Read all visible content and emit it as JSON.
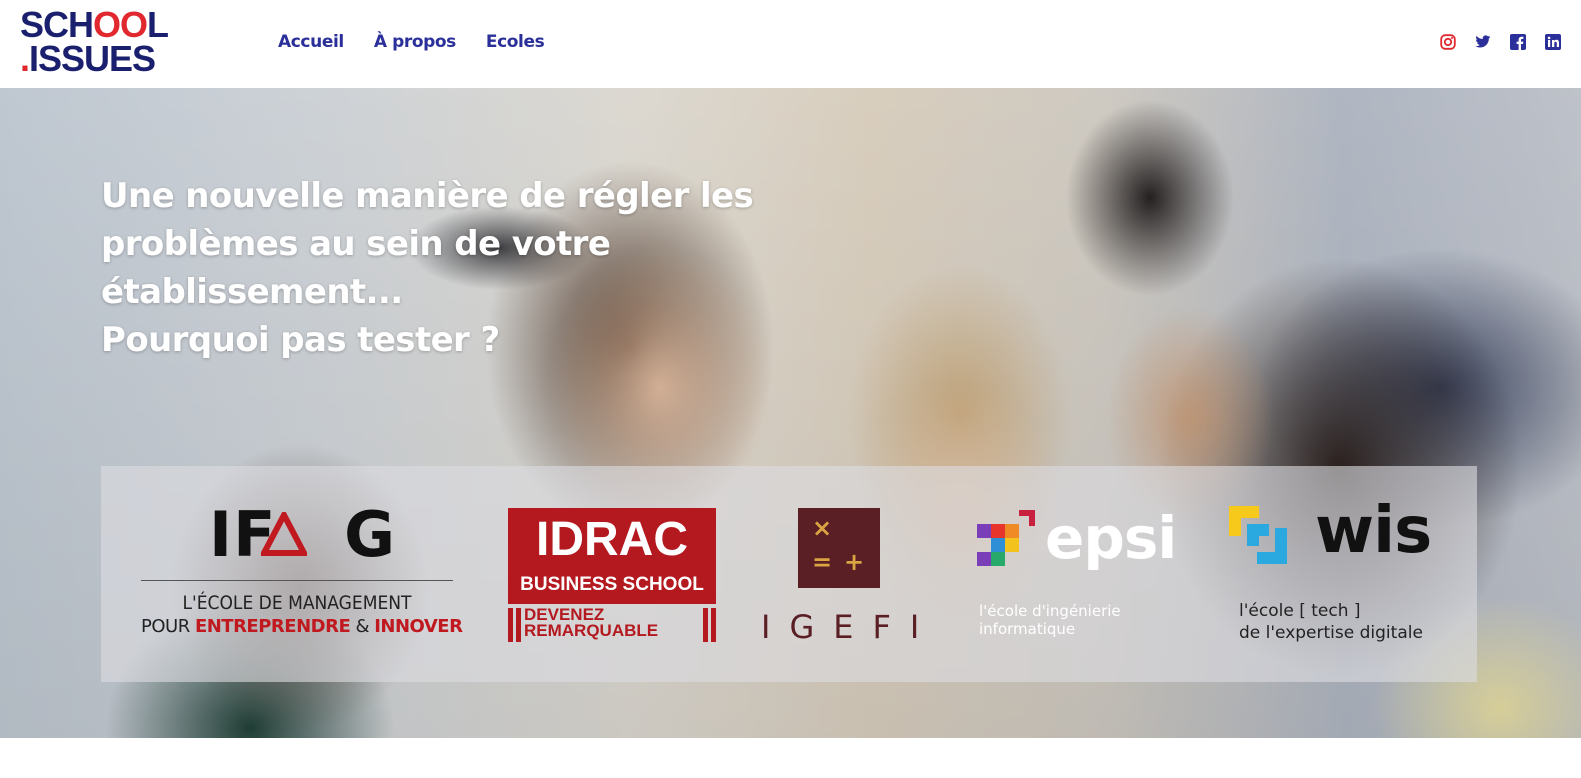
{
  "logo": {
    "line1_a": "SCH",
    "line1_o1": "O",
    "line1_o2": "O",
    "line1_b": "L",
    "line2_dot": ".",
    "line2": "ISSUES"
  },
  "nav": {
    "items": [
      {
        "label": "Accueil"
      },
      {
        "label": "À propos"
      },
      {
        "label": "Ecoles"
      }
    ]
  },
  "social": {
    "icons": [
      "instagram-icon",
      "twitter-icon",
      "facebook-icon",
      "linkedin-icon"
    ],
    "color": "#2a2f9a",
    "instagram_color": "#e0282e"
  },
  "hero": {
    "lines": [
      "Une nouvelle manière de régler les",
      "problèmes au sein de votre",
      "établissement...",
      "Pourquoi pas tester ?"
    ]
  },
  "schools": {
    "ifag": {
      "name": "IFAG",
      "tagline_1": "L'ÉCOLE DE MANAGEMENT",
      "tagline_2_a": "POUR ",
      "tagline_2_b": "ENTREPRENDRE",
      "tagline_2_c": " & ",
      "tagline_2_d": "INNOVER"
    },
    "idrac": {
      "name": "IDRAC",
      "sub": "BUSINESS SCHOOL",
      "tag_1": "DEVENEZ",
      "tag_2": "REMARQUABLE"
    },
    "igefi": {
      "name": "IGEFI",
      "sym_1": "×",
      "sym_2": "=",
      "sym_3": "+"
    },
    "epsi": {
      "name": "epsi",
      "sub_1": "l'école d'ingénierie",
      "sub_2": "informatique"
    },
    "wis": {
      "name": "wis",
      "sub_1": "l'école [ tech ]",
      "sub_2": "de l'expertise digitale"
    }
  },
  "colors": {
    "brand_navy": "#1a1f6e",
    "brand_red": "#e0282e",
    "idrac_red": "#b3191f",
    "igefi_maroon": "#5a1f24"
  }
}
